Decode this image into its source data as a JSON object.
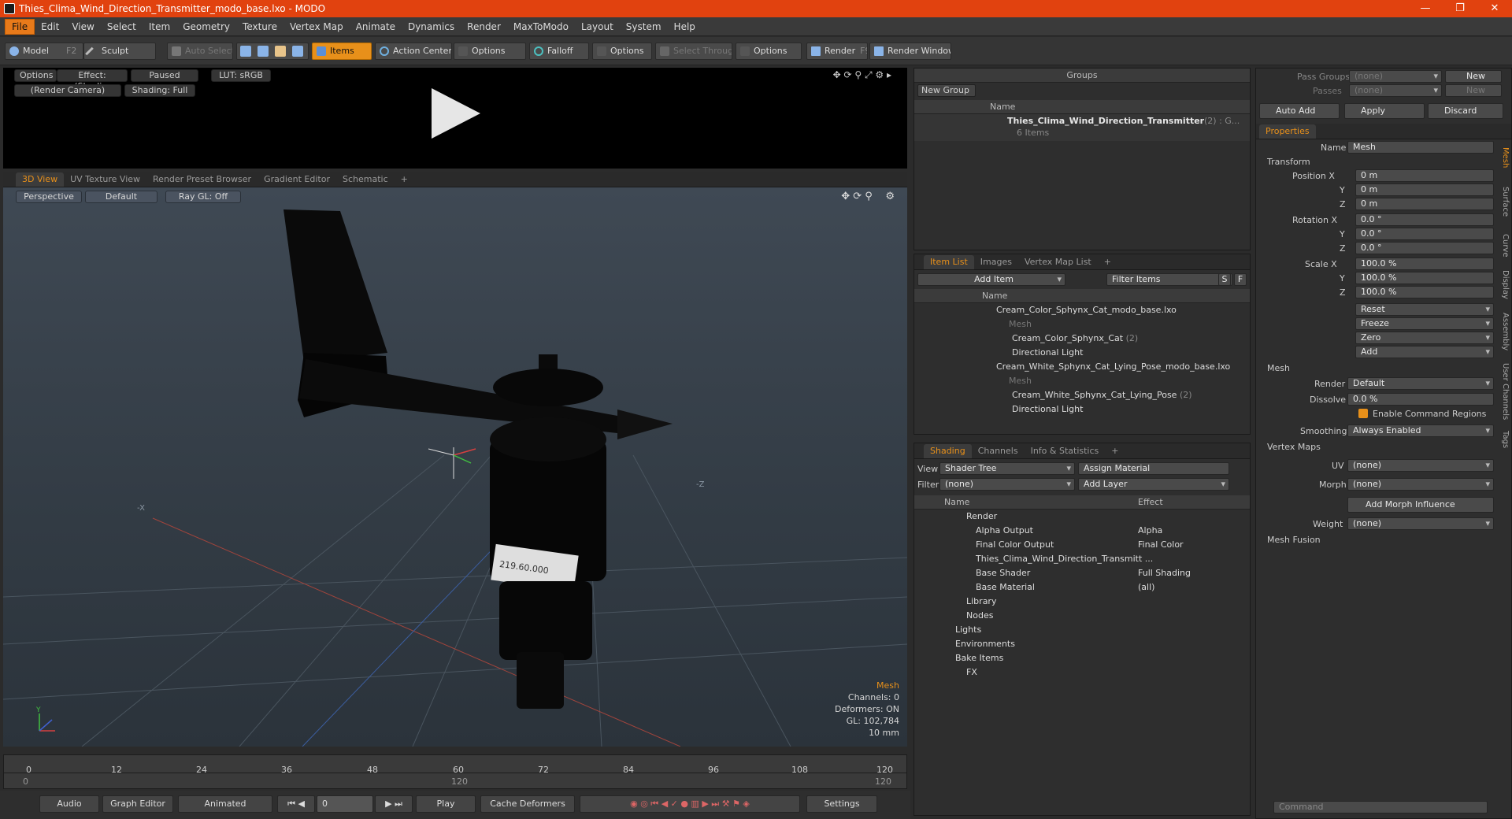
{
  "window": {
    "title": "Thies_Clima_Wind_Direction_Transmitter_modo_base.lxo - MODO",
    "minimize": "—",
    "maximize": "❐",
    "close": "✕"
  },
  "menu": [
    "File",
    "Edit",
    "View",
    "Select",
    "Item",
    "Geometry",
    "Texture",
    "Vertex Map",
    "Animate",
    "Dynamics",
    "Render",
    "MaxToModo",
    "Layout",
    "System",
    "Help"
  ],
  "toolbar": {
    "model": "Model",
    "model_key": "F2",
    "sculpt": "Sculpt",
    "auto_select": "Auto Select",
    "items": "Items",
    "action_center": "Action Center",
    "options1": "Options",
    "falloff": "Falloff",
    "options2": "Options",
    "select_through": "Select Through",
    "options3": "Options",
    "render": "Render",
    "render_key": "F9",
    "render_window": "Render Window"
  },
  "preview": {
    "options": "Options",
    "effect": "Effect: (Shadi...",
    "paused": "Paused",
    "lut": "LUT: sRGB",
    "camera": "(Render Camera)",
    "shading": "Shading: Full"
  },
  "viewport_tabs": [
    "3D View",
    "UV Texture View",
    "Render Preset Browser",
    "Gradient Editor",
    "Schematic",
    "+"
  ],
  "viewport": {
    "perspective": "Perspective",
    "default": "Default",
    "raygl": "Ray GL: Off",
    "label_text": "219.60.000",
    "info_title": "Mesh",
    "info_lines": [
      "Channels: 0",
      "Deformers: ON",
      "GL: 102,784",
      "10 mm"
    ],
    "axis_x": "-X",
    "axis_z": "-Z",
    "axis_y": "Y"
  },
  "timeline": {
    "ticks": [
      "0",
      "12",
      "24",
      "36",
      "48",
      "60",
      "72",
      "84",
      "96",
      "108",
      "120"
    ],
    "sub": [
      "0",
      "120",
      "120"
    ]
  },
  "bottom": {
    "audio": "Audio",
    "graph_editor": "Graph Editor",
    "animated": "Animated",
    "frame": "0",
    "play": "Play",
    "cache": "Cache Deformers",
    "settings": "Settings"
  },
  "groups": {
    "title": "Groups",
    "new_group": "New Group",
    "col_name": "Name",
    "item_name": "Thies_Clima_Wind_Direction_Transmitter",
    "item_count": "(2) : G...",
    "item_sub": "6 Items"
  },
  "itemlist": {
    "tabs": [
      "Item List",
      "Images",
      "Vertex Map List",
      "+"
    ],
    "add_item": "Add Item",
    "filter": "Filter Items",
    "s": "S",
    "f": "F",
    "col_name": "Name",
    "rows": [
      "Cream_Color_Sphynx_Cat_modo_base.lxo",
      "Mesh",
      "Cream_Color_Sphynx_Cat",
      "Directional Light",
      "Cream_White_Sphynx_Cat_Lying_Pose_modo_base.lxo",
      "Mesh",
      "Cream_White_Sphynx_Cat_Lying_Pose",
      "Directional Light"
    ],
    "count": "(2)"
  },
  "shading": {
    "tabs": [
      "Shading",
      "Channels",
      "Info & Statistics",
      "+"
    ],
    "view_label": "View",
    "view": "Shader Tree",
    "assign": "Assign Material",
    "filter_label": "Filter",
    "filter": "(none)",
    "add_layer": "Add Layer",
    "col_name": "Name",
    "col_effect": "Effect",
    "rows": [
      {
        "n": "Render",
        "e": ""
      },
      {
        "n": "Alpha Output",
        "e": "Alpha"
      },
      {
        "n": "Final Color Output",
        "e": "Final Color"
      },
      {
        "n": "Thies_Clima_Wind_Direction_Transmitt ...",
        "e": ""
      },
      {
        "n": "Base Shader",
        "e": "Full Shading"
      },
      {
        "n": "Base Material",
        "e": "(all)"
      },
      {
        "n": "Library",
        "e": ""
      },
      {
        "n": "Nodes",
        "e": ""
      },
      {
        "n": "Lights",
        "e": ""
      },
      {
        "n": "Environments",
        "e": ""
      },
      {
        "n": "Bake Items",
        "e": ""
      },
      {
        "n": "FX",
        "e": ""
      }
    ]
  },
  "props": {
    "pass_groups": "Pass Groups",
    "passes": "Passes",
    "none": "(none)",
    "new": "New",
    "auto_add": "Auto Add",
    "apply": "Apply",
    "discard": "Discard",
    "tab": "Properties",
    "name_label": "Name",
    "name": "Mesh",
    "transform": "Transform",
    "position": [
      "Position X",
      "Y",
      "Z"
    ],
    "pos_vals": [
      "0 m",
      "0 m",
      "0 m"
    ],
    "rotation": [
      "Rotation X",
      "Y",
      "Z"
    ],
    "rot_vals": [
      "0.0 °",
      "0.0 °",
      "0.0 °"
    ],
    "scale": [
      "Scale X",
      "Y",
      "Z"
    ],
    "scale_vals": [
      "100.0 %",
      "100.0 %",
      "100.0 %"
    ],
    "actions": [
      "Reset",
      "Freeze",
      "Zero",
      "Add"
    ],
    "mesh": "Mesh",
    "render_label": "Render",
    "render": "Default",
    "dissolve_label": "Dissolve",
    "dissolve": "0.0 %",
    "ecr": "Enable Command Regions",
    "smoothing_label": "Smoothing",
    "smoothing": "Always Enabled",
    "vertex_maps": "Vertex Maps",
    "uv_label": "UV",
    "uv": "(none)",
    "morph_label": "Morph",
    "morph": "(none)",
    "add_morph": "Add Morph Influence",
    "weight_label": "Weight",
    "weight": "(none)",
    "mesh_fusion": "Mesh Fusion",
    "side_tabs": [
      "Mesh",
      "Surface",
      "Curve",
      "Display",
      "Assembly",
      "User Channels",
      "Tags"
    ],
    "command": "Command"
  }
}
